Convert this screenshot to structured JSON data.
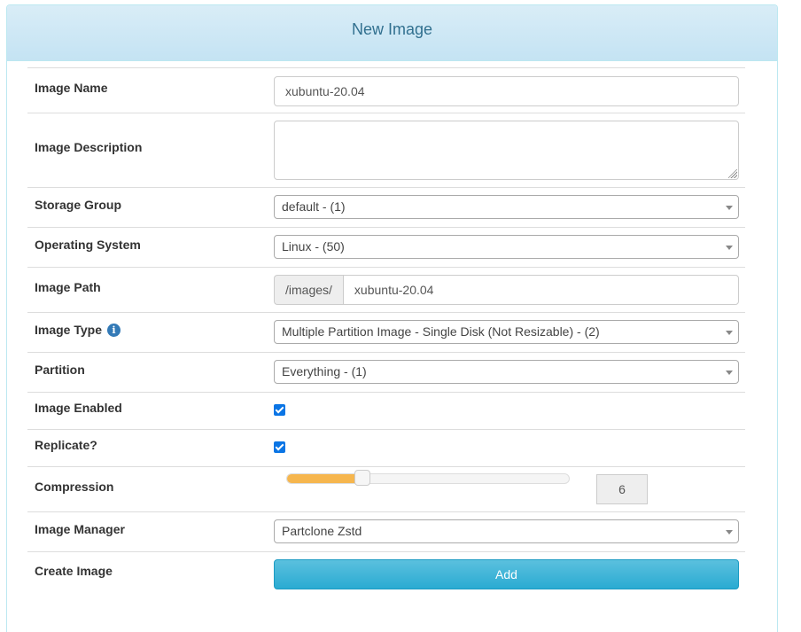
{
  "panel": {
    "title": "New Image"
  },
  "form": {
    "image_name": {
      "label": "Image Name",
      "value": "xubuntu-20.04"
    },
    "image_description": {
      "label": "Image Description",
      "value": ""
    },
    "storage_group": {
      "label": "Storage Group",
      "selected": "default - (1)"
    },
    "operating_system": {
      "label": "Operating System",
      "selected": "Linux - (50)"
    },
    "image_path": {
      "label": "Image Path",
      "prefix": "/images/",
      "value": "xubuntu-20.04"
    },
    "image_type": {
      "label": "Image Type",
      "info_icon": "info-circle-icon",
      "selected": "Multiple Partition Image - Single Disk (Not Resizable) - (2)"
    },
    "partition": {
      "label": "Partition",
      "selected": "Everything - (1)"
    },
    "image_enabled": {
      "label": "Image Enabled",
      "checked": true
    },
    "replicate": {
      "label": "Replicate?",
      "checked": true
    },
    "compression": {
      "label": "Compression",
      "value": "6",
      "slider_fraction": 0.27
    },
    "image_manager": {
      "label": "Image Manager",
      "selected": "Partclone Zstd"
    },
    "create_image": {
      "label": "Create Image",
      "button_label": "Add"
    }
  },
  "colors": {
    "heading_bg": "#d9edf7",
    "heading_text": "#31708f",
    "checkbox": "#0a75e5",
    "slider_fill": "#f6b64e",
    "add_button": "#5bc0de"
  }
}
